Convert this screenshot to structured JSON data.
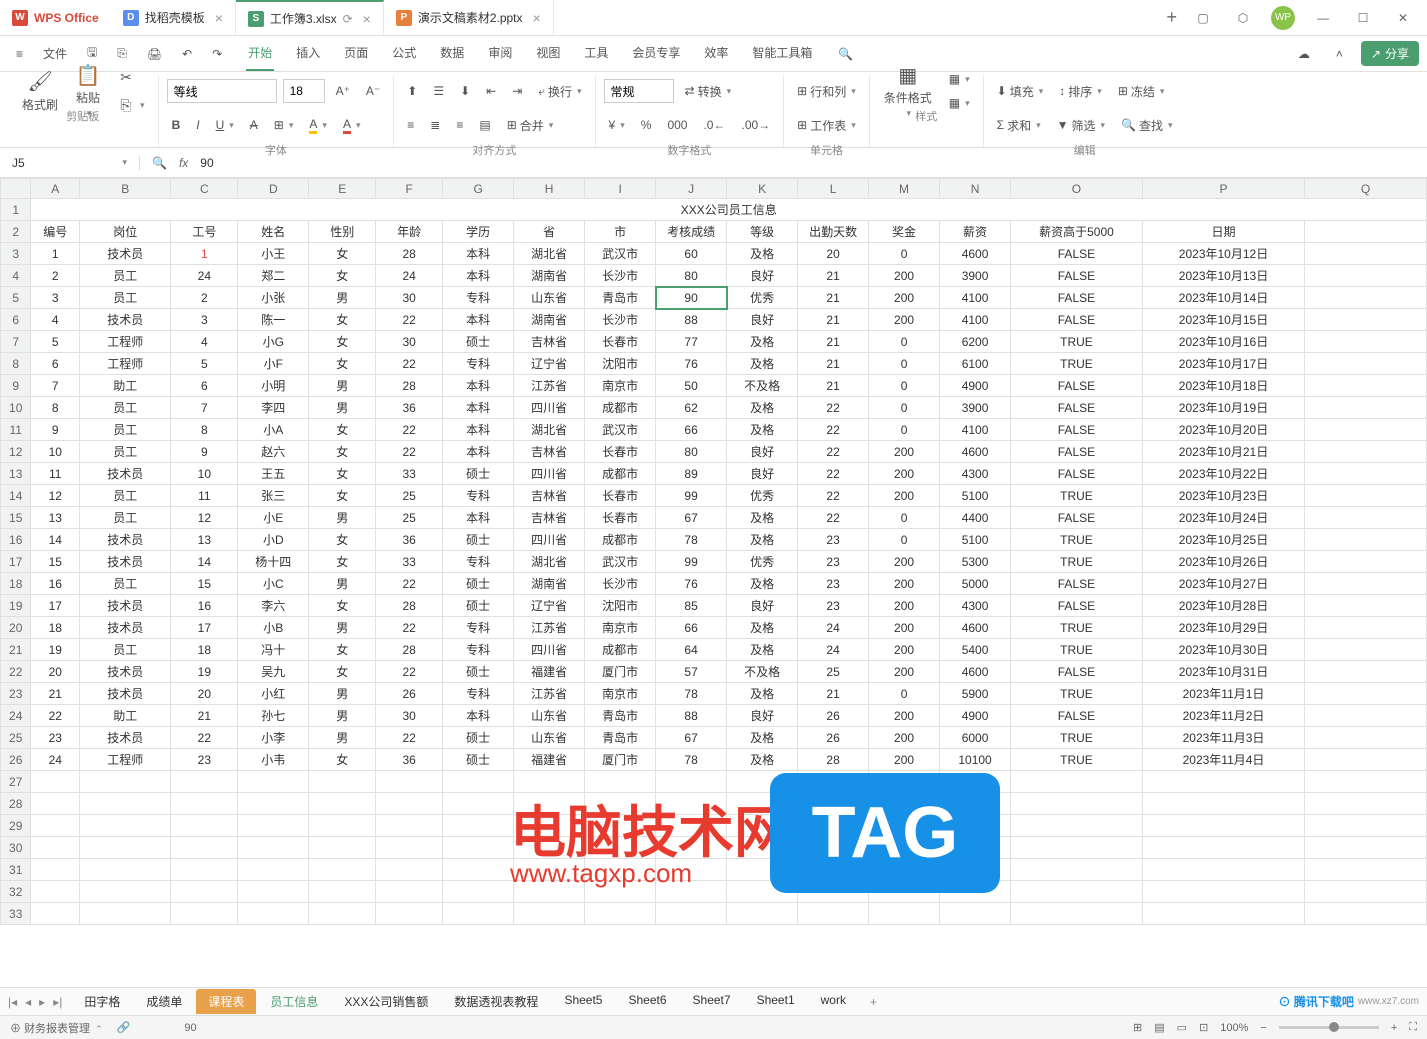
{
  "app_name": "WPS Office",
  "tabs": [
    {
      "icon": "doc",
      "label": "找稻壳模板"
    },
    {
      "icon": "xls",
      "label": "工作簿3.xlsx",
      "active": true
    },
    {
      "icon": "ppt",
      "label": "演示文稿素材2.pptx"
    }
  ],
  "avatar_text": "WP",
  "menu": {
    "file": "文件",
    "items": [
      "开始",
      "插入",
      "页面",
      "公式",
      "数据",
      "审阅",
      "视图",
      "工具",
      "会员专享",
      "效率",
      "智能工具箱"
    ],
    "active": "开始",
    "share": "分享"
  },
  "ribbon": {
    "clipboard": {
      "format_brush": "格式刷",
      "paste": "粘贴",
      "label": "剪贴板"
    },
    "font": {
      "name": "等线",
      "size": "18",
      "label": "字体"
    },
    "align": {
      "wrap": "换行",
      "merge": "合并",
      "label": "对齐方式"
    },
    "number": {
      "format": "常规",
      "convert": "转换",
      "label": "数字格式"
    },
    "cells": {
      "rowcol": "行和列",
      "worksheet": "工作表",
      "label": "单元格"
    },
    "style": {
      "cond": "条件格式",
      "label": "样式"
    },
    "edit": {
      "fill": "填充",
      "sum": "求和",
      "sort": "排序",
      "filter": "筛选",
      "freeze": "冻结",
      "find": "查找",
      "label": "编辑"
    }
  },
  "formula_bar": {
    "cell_ref": "J5",
    "value": "90"
  },
  "columns": [
    "A",
    "B",
    "C",
    "D",
    "E",
    "F",
    "G",
    "H",
    "I",
    "J",
    "K",
    "L",
    "M",
    "N",
    "O",
    "P",
    "Q"
  ],
  "title_row": "XXX公司员工信息",
  "headers": [
    "编号",
    "岗位",
    "工号",
    "姓名",
    "性别",
    "年龄",
    "学历",
    "省",
    "市",
    "考核成绩",
    "等级",
    "出勤天数",
    "奖金",
    "薪资",
    "薪资高于5000",
    "日期"
  ],
  "rows": [
    [
      "1",
      "技术员",
      "1",
      "小王",
      "女",
      "28",
      "本科",
      "湖北省",
      "武汉市",
      "60",
      "及格",
      "20",
      "0",
      "4600",
      "FALSE",
      "2023年10月12日"
    ],
    [
      "2",
      "员工",
      "24",
      "郑二",
      "女",
      "24",
      "本科",
      "湖南省",
      "长沙市",
      "80",
      "良好",
      "21",
      "200",
      "3900",
      "FALSE",
      "2023年10月13日"
    ],
    [
      "3",
      "员工",
      "2",
      "小张",
      "男",
      "30",
      "专科",
      "山东省",
      "青岛市",
      "90",
      "优秀",
      "21",
      "200",
      "4100",
      "FALSE",
      "2023年10月14日"
    ],
    [
      "4",
      "技术员",
      "3",
      "陈一",
      "女",
      "22",
      "本科",
      "湖南省",
      "长沙市",
      "88",
      "良好",
      "21",
      "200",
      "4100",
      "FALSE",
      "2023年10月15日"
    ],
    [
      "5",
      "工程师",
      "4",
      "小G",
      "女",
      "30",
      "硕士",
      "吉林省",
      "长春市",
      "77",
      "及格",
      "21",
      "0",
      "6200",
      "TRUE",
      "2023年10月16日"
    ],
    [
      "6",
      "工程师",
      "5",
      "小F",
      "女",
      "22",
      "专科",
      "辽宁省",
      "沈阳市",
      "76",
      "及格",
      "21",
      "0",
      "6100",
      "TRUE",
      "2023年10月17日"
    ],
    [
      "7",
      "助工",
      "6",
      "小明",
      "男",
      "28",
      "本科",
      "江苏省",
      "南京市",
      "50",
      "不及格",
      "21",
      "0",
      "4900",
      "FALSE",
      "2023年10月18日"
    ],
    [
      "8",
      "员工",
      "7",
      "李四",
      "男",
      "36",
      "本科",
      "四川省",
      "成都市",
      "62",
      "及格",
      "22",
      "0",
      "3900",
      "FALSE",
      "2023年10月19日"
    ],
    [
      "9",
      "员工",
      "8",
      "小A",
      "女",
      "22",
      "本科",
      "湖北省",
      "武汉市",
      "66",
      "及格",
      "22",
      "0",
      "4100",
      "FALSE",
      "2023年10月20日"
    ],
    [
      "10",
      "员工",
      "9",
      "赵六",
      "女",
      "22",
      "本科",
      "吉林省",
      "长春市",
      "80",
      "良好",
      "22",
      "200",
      "4600",
      "FALSE",
      "2023年10月21日"
    ],
    [
      "11",
      "技术员",
      "10",
      "王五",
      "女",
      "33",
      "硕士",
      "四川省",
      "成都市",
      "89",
      "良好",
      "22",
      "200",
      "4300",
      "FALSE",
      "2023年10月22日"
    ],
    [
      "12",
      "员工",
      "11",
      "张三",
      "女",
      "25",
      "专科",
      "吉林省",
      "长春市",
      "99",
      "优秀",
      "22",
      "200",
      "5100",
      "TRUE",
      "2023年10月23日"
    ],
    [
      "13",
      "员工",
      "12",
      "小E",
      "男",
      "25",
      "本科",
      "吉林省",
      "长春市",
      "67",
      "及格",
      "22",
      "0",
      "4400",
      "FALSE",
      "2023年10月24日"
    ],
    [
      "14",
      "技术员",
      "13",
      "小D",
      "女",
      "36",
      "硕士",
      "四川省",
      "成都市",
      "78",
      "及格",
      "23",
      "0",
      "5100",
      "TRUE",
      "2023年10月25日"
    ],
    [
      "15",
      "技术员",
      "14",
      "杨十四",
      "女",
      "33",
      "专科",
      "湖北省",
      "武汉市",
      "99",
      "优秀",
      "23",
      "200",
      "5300",
      "TRUE",
      "2023年10月26日"
    ],
    [
      "16",
      "员工",
      "15",
      "小C",
      "男",
      "22",
      "硕士",
      "湖南省",
      "长沙市",
      "76",
      "及格",
      "23",
      "200",
      "5000",
      "FALSE",
      "2023年10月27日"
    ],
    [
      "17",
      "技术员",
      "16",
      "李六",
      "女",
      "28",
      "硕士",
      "辽宁省",
      "沈阳市",
      "85",
      "良好",
      "23",
      "200",
      "4300",
      "FALSE",
      "2023年10月28日"
    ],
    [
      "18",
      "技术员",
      "17",
      "小B",
      "男",
      "22",
      "专科",
      "江苏省",
      "南京市",
      "66",
      "及格",
      "24",
      "200",
      "4600",
      "TRUE",
      "2023年10月29日"
    ],
    [
      "19",
      "员工",
      "18",
      "冯十",
      "女",
      "28",
      "专科",
      "四川省",
      "成都市",
      "64",
      "及格",
      "24",
      "200",
      "5400",
      "TRUE",
      "2023年10月30日"
    ],
    [
      "20",
      "技术员",
      "19",
      "吴九",
      "女",
      "22",
      "硕士",
      "福建省",
      "厦门市",
      "57",
      "不及格",
      "25",
      "200",
      "4600",
      "FALSE",
      "2023年10月31日"
    ],
    [
      "21",
      "技术员",
      "20",
      "小红",
      "男",
      "26",
      "专科",
      "江苏省",
      "南京市",
      "78",
      "及格",
      "21",
      "0",
      "5900",
      "TRUE",
      "2023年11月1日"
    ],
    [
      "22",
      "助工",
      "21",
      "孙七",
      "男",
      "30",
      "本科",
      "山东省",
      "青岛市",
      "88",
      "良好",
      "26",
      "200",
      "4900",
      "FALSE",
      "2023年11月2日"
    ],
    [
      "23",
      "技术员",
      "22",
      "小李",
      "男",
      "22",
      "硕士",
      "山东省",
      "青岛市",
      "67",
      "及格",
      "26",
      "200",
      "6000",
      "TRUE",
      "2023年11月3日"
    ],
    [
      "24",
      "工程师",
      "23",
      "小韦",
      "女",
      "36",
      "硕士",
      "福建省",
      "厦门市",
      "78",
      "及格",
      "28",
      "200",
      "10100",
      "TRUE",
      "2023年11月4日"
    ]
  ],
  "selected_cell": {
    "row": 3,
    "col": 9
  },
  "red_cell": {
    "row": 1,
    "col": 2
  },
  "sheet_tabs": [
    "田字格",
    "成绩单",
    "课程表",
    "员工信息",
    "XXX公司销售额",
    "数据透视表教程",
    "Sheet5",
    "Sheet6",
    "Sheet7",
    "Sheet1",
    "work"
  ],
  "active_sheet": "员工信息",
  "hl_sheet": "课程表",
  "statusbar": {
    "left": "财务报表管理",
    "zoom": "100%",
    "formula_val": "90"
  },
  "watermark": {
    "main": "电脑技术网",
    "sub": "www.tagxp.com",
    "badge": "TAG"
  }
}
